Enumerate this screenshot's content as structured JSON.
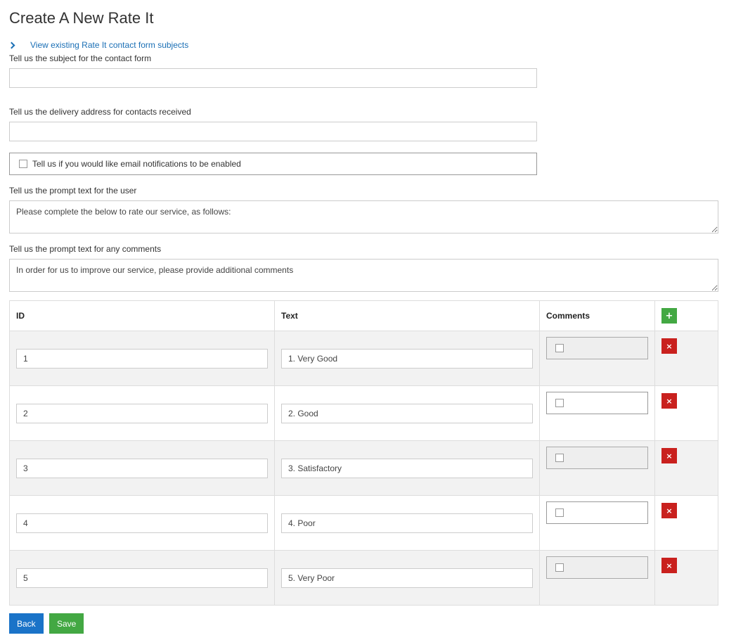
{
  "page": {
    "title": "Create A New Rate It"
  },
  "link": {
    "existing": "View existing Rate It contact form subjects"
  },
  "form": {
    "subject_label": "Tell us the subject for the contact form",
    "subject_value": "",
    "delivery_label": "Tell us the delivery address for contacts received",
    "delivery_value": "",
    "notify_label": "Tell us if you would like email notifications to be enabled",
    "prompt_label": "Tell us the prompt text for the user",
    "prompt_value": "Please complete the below to rate our service, as follows:",
    "comments_label": "Tell us the prompt text for any comments",
    "comments_value": "In order for us to improve our service, please provide additional comments"
  },
  "table": {
    "headers": {
      "id": "ID",
      "text": "Text",
      "comments": "Comments",
      "add": "+"
    },
    "delete_glyph": "×",
    "rows": [
      {
        "id": "1",
        "text": "1. Very Good"
      },
      {
        "id": "2",
        "text": "2. Good"
      },
      {
        "id": "3",
        "text": "3. Satisfactory"
      },
      {
        "id": "4",
        "text": "4. Poor"
      },
      {
        "id": "5",
        "text": "5. Very Poor"
      }
    ]
  },
  "buttons": {
    "back": "Back",
    "save": "Save"
  },
  "colors": {
    "link": "#1a6fb5",
    "add": "#43a843",
    "delete": "#c9211e",
    "back": "#1a73c8",
    "save": "#43a843"
  }
}
